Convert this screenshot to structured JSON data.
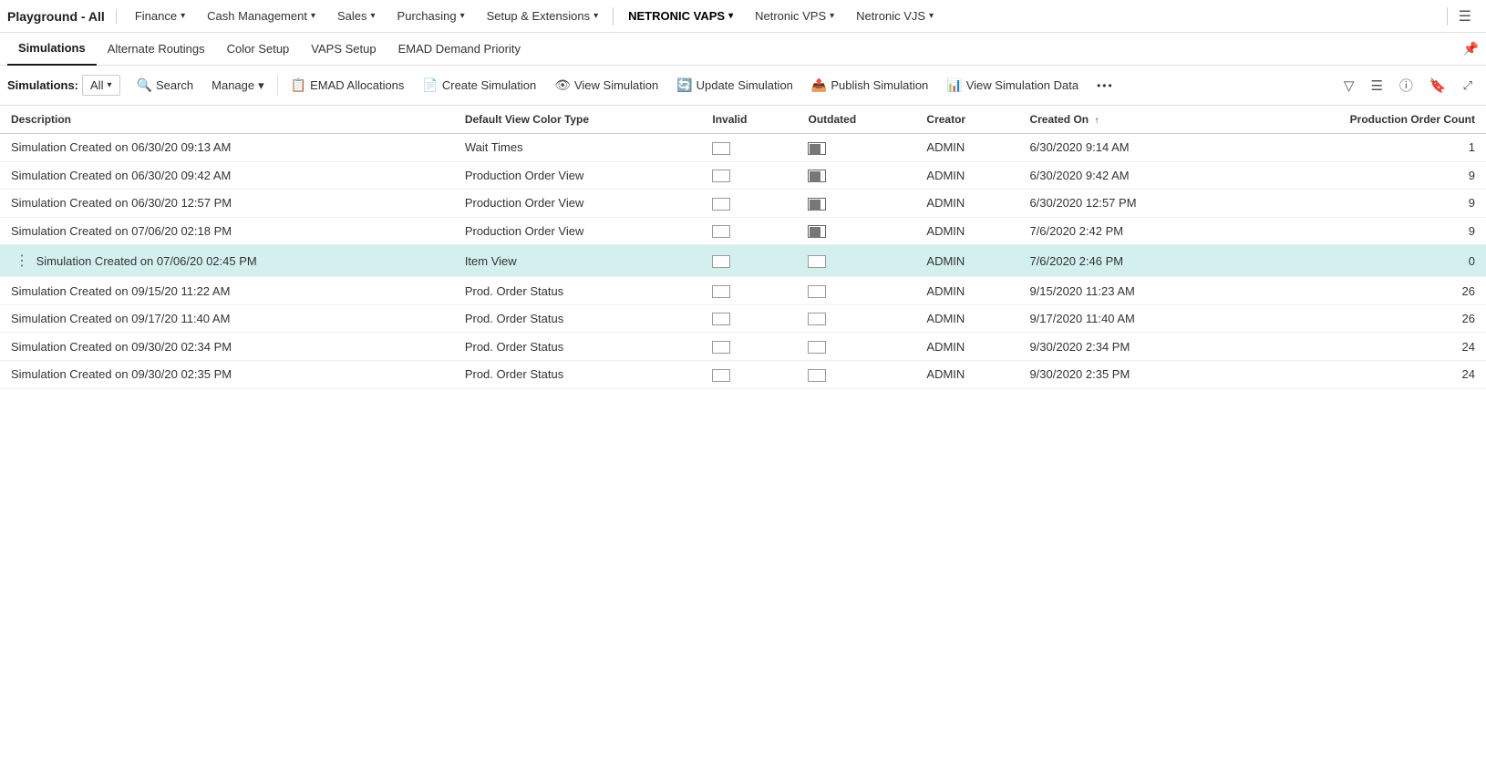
{
  "app": {
    "title": "Playground - All",
    "hamburger_icon": "☰"
  },
  "top_nav": {
    "items": [
      {
        "id": "finance",
        "label": "Finance",
        "has_dropdown": true
      },
      {
        "id": "cash-management",
        "label": "Cash Management",
        "has_dropdown": true
      },
      {
        "id": "sales",
        "label": "Sales",
        "has_dropdown": true
      },
      {
        "id": "purchasing",
        "label": "Purchasing",
        "has_dropdown": true
      },
      {
        "id": "setup-extensions",
        "label": "Setup & Extensions",
        "has_dropdown": true
      },
      {
        "id": "netronic-vaps",
        "label": "NETRONIC VAPS",
        "has_dropdown": true,
        "active": true
      },
      {
        "id": "netronic-vps",
        "label": "Netronic VPS",
        "has_dropdown": true
      },
      {
        "id": "netronic-vjs",
        "label": "Netronic VJS",
        "has_dropdown": true
      }
    ]
  },
  "secondary_nav": {
    "items": [
      {
        "id": "simulations",
        "label": "Simulations",
        "active": true
      },
      {
        "id": "alternate-routings",
        "label": "Alternate Routings"
      },
      {
        "id": "color-setup",
        "label": "Color Setup"
      },
      {
        "id": "vaps-setup",
        "label": "VAPS Setup"
      },
      {
        "id": "emad-demand-priority",
        "label": "EMAD Demand Priority"
      }
    ],
    "pin_icon": "📌"
  },
  "toolbar": {
    "label": "Simulations:",
    "all_dropdown": "All",
    "buttons": [
      {
        "id": "search",
        "icon": "🔍",
        "label": "Search"
      },
      {
        "id": "manage",
        "icon": "",
        "label": "Manage",
        "has_dropdown": true
      },
      {
        "id": "emad-allocations",
        "icon": "📋",
        "label": "EMAD Allocations"
      },
      {
        "id": "create-simulation",
        "icon": "📄",
        "label": "Create Simulation"
      },
      {
        "id": "view-simulation",
        "icon": "👁",
        "label": "View Simulation"
      },
      {
        "id": "update-simulation",
        "icon": "🔄",
        "label": "Update Simulation"
      },
      {
        "id": "publish-simulation",
        "icon": "📤",
        "label": "Publish Simulation"
      },
      {
        "id": "view-simulation-data",
        "icon": "📊",
        "label": "View Simulation Data"
      },
      {
        "id": "more",
        "icon": "•••",
        "label": ""
      }
    ],
    "right_icons": [
      {
        "id": "filter",
        "icon": "▽",
        "label": "filter-icon"
      },
      {
        "id": "list-view",
        "icon": "≡",
        "label": "list-view-icon"
      },
      {
        "id": "info",
        "icon": "ⓘ",
        "label": "info-icon"
      },
      {
        "id": "bookmark",
        "icon": "🔖",
        "label": "bookmark-icon"
      },
      {
        "id": "expand",
        "icon": "⤢",
        "label": "expand-icon"
      }
    ]
  },
  "table": {
    "columns": [
      {
        "id": "description",
        "label": "Description"
      },
      {
        "id": "default-view-color-type",
        "label": "Default View Color Type"
      },
      {
        "id": "invalid",
        "label": "Invalid"
      },
      {
        "id": "outdated",
        "label": "Outdated"
      },
      {
        "id": "creator",
        "label": "Creator"
      },
      {
        "id": "created-on",
        "label": "Created On",
        "sort": "asc"
      },
      {
        "id": "production-order-count",
        "label": "Production Order Count",
        "align": "right"
      }
    ],
    "rows": [
      {
        "id": 1,
        "description": "Simulation Created on 06/30/20 09:13 AM",
        "default_view_color_type": "Wait Times",
        "invalid": false,
        "outdated": true,
        "creator": "ADMIN",
        "created_on": "6/30/2020 9:14 AM",
        "production_order_count": "1",
        "selected": false
      },
      {
        "id": 2,
        "description": "Simulation Created on 06/30/20 09:42 AM",
        "default_view_color_type": "Production Order View",
        "invalid": false,
        "outdated": true,
        "creator": "ADMIN",
        "created_on": "6/30/2020 9:42 AM",
        "production_order_count": "9",
        "selected": false
      },
      {
        "id": 3,
        "description": "Simulation Created on 06/30/20 12:57 PM",
        "default_view_color_type": "Production Order View",
        "invalid": false,
        "outdated": true,
        "creator": "ADMIN",
        "created_on": "6/30/2020 12:57 PM",
        "production_order_count": "9",
        "selected": false
      },
      {
        "id": 4,
        "description": "Simulation Created on 07/06/20 02:18 PM",
        "default_view_color_type": "Production Order View",
        "invalid": false,
        "outdated": true,
        "creator": "ADMIN",
        "created_on": "7/6/2020 2:42 PM",
        "production_order_count": "9",
        "selected": false
      },
      {
        "id": 5,
        "description": "Simulation Created on 07/06/20 02:45 PM",
        "default_view_color_type": "Item View",
        "invalid": false,
        "outdated": false,
        "creator": "ADMIN",
        "created_on": "7/6/2020 2:46 PM",
        "production_order_count": "0",
        "selected": true,
        "has_menu": true
      },
      {
        "id": 6,
        "description": "Simulation Created on 09/15/20 11:22 AM",
        "default_view_color_type": "Prod. Order Status",
        "invalid": false,
        "outdated": false,
        "creator": "ADMIN",
        "created_on": "9/15/2020 11:23 AM",
        "production_order_count": "26",
        "selected": false
      },
      {
        "id": 7,
        "description": "Simulation Created on 09/17/20 11:40 AM",
        "default_view_color_type": "Prod. Order Status",
        "invalid": false,
        "outdated": false,
        "creator": "ADMIN",
        "created_on": "9/17/2020 11:40 AM",
        "production_order_count": "26",
        "selected": false
      },
      {
        "id": 8,
        "description": "Simulation Created on 09/30/20 02:34 PM",
        "default_view_color_type": "Prod. Order Status",
        "invalid": false,
        "outdated": false,
        "creator": "ADMIN",
        "created_on": "9/30/2020 2:34 PM",
        "production_order_count": "24",
        "selected": false
      },
      {
        "id": 9,
        "description": "Simulation Created on 09/30/20 02:35 PM",
        "default_view_color_type": "Prod. Order Status",
        "invalid": false,
        "outdated": false,
        "creator": "ADMIN",
        "created_on": "9/30/2020 2:35 PM",
        "production_order_count": "24",
        "selected": false
      }
    ]
  },
  "colors": {
    "selected_row_bg": "#d4f0ee",
    "link_color": "#0066cc",
    "nav_active_color": "#000",
    "accent": "#0078d4"
  }
}
